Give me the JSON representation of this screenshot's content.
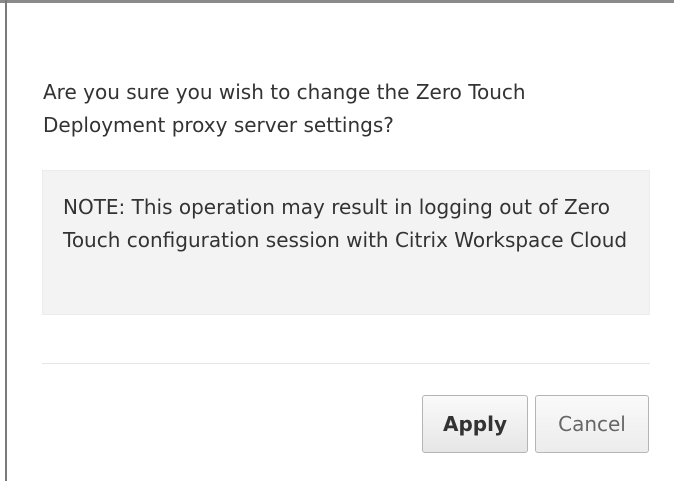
{
  "dialog": {
    "message": "Are you sure you wish to change the Zero Touch Deployment proxy server settings?",
    "note": "NOTE: This operation may result in logging out of Zero Touch configuration session with Citrix Workspace Cloud",
    "apply_label": "Apply",
    "cancel_label": "Cancel"
  }
}
